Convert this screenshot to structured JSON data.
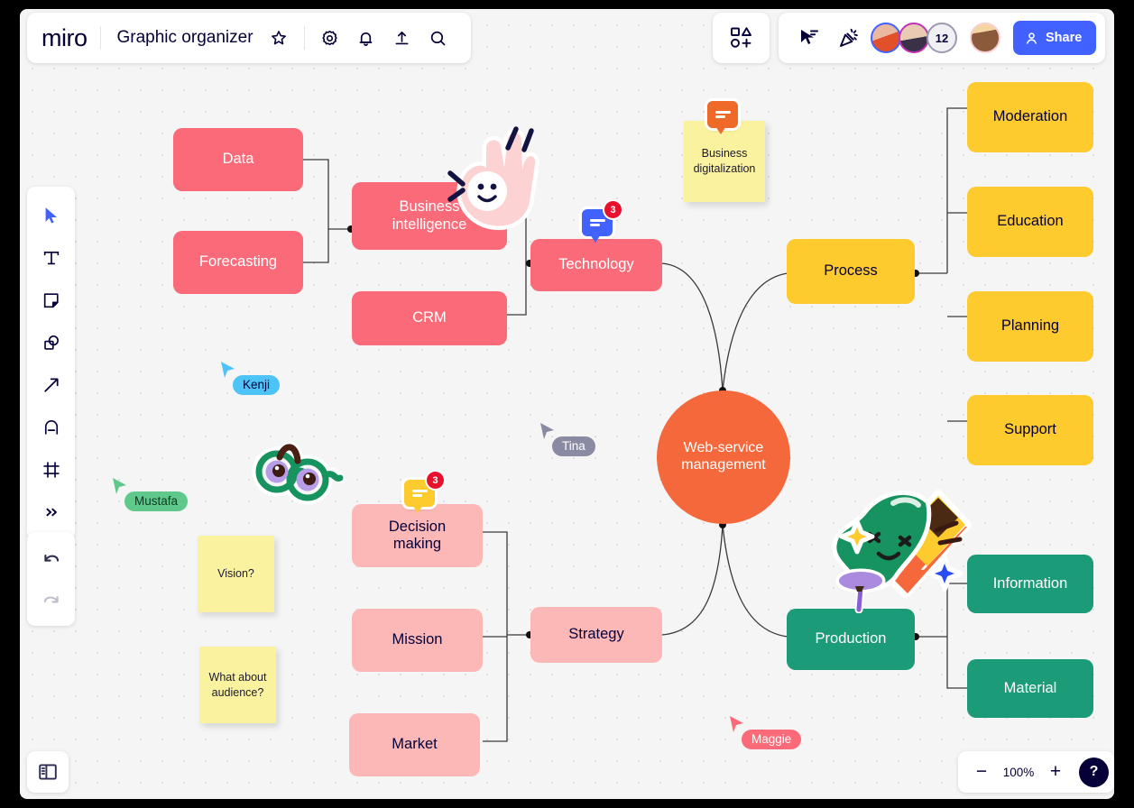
{
  "app": {
    "logo": "miro",
    "board_title": "Graphic organizer"
  },
  "header": {
    "icons": [
      "star-icon",
      "gear-icon",
      "bell-icon",
      "upload-icon",
      "search-icon"
    ],
    "shapes_button": "shapes-plus-icon",
    "present_icon": "present-icon",
    "celebrate_icon": "celebrate-icon",
    "collaborator_count": "12",
    "share_label": "Share"
  },
  "toolbar": {
    "tools": [
      {
        "name": "select-tool",
        "glyph": "cursor"
      },
      {
        "name": "text-tool",
        "glyph": "T"
      },
      {
        "name": "sticky-note-tool",
        "glyph": "note"
      },
      {
        "name": "shapes-tool",
        "glyph": "shapes"
      },
      {
        "name": "connector-tool",
        "glyph": "arrow"
      },
      {
        "name": "pen-tool",
        "glyph": "pen"
      },
      {
        "name": "frame-tool",
        "glyph": "frame"
      },
      {
        "name": "more-tools",
        "glyph": "»"
      }
    ],
    "undo": "undo-icon",
    "redo": "redo-icon"
  },
  "footer": {
    "panel_toggle": "panel-toggle-icon",
    "zoom_out": "−",
    "zoom_level": "100%",
    "zoom_in": "+",
    "help": "?"
  },
  "colors": {
    "red": "#fa6a78",
    "light_pink": "#fcb7b7",
    "yellow": "#fecb2e",
    "green": "#1c9b78",
    "orange": "#f4683c",
    "sticky_yellow": "#fbf2a0",
    "brand_blue": "#4262ff",
    "ink": "#050038"
  },
  "mindmap": {
    "center": {
      "label": "Web-service\nmanagement",
      "color": "#f4683c",
      "text": "#ffffff"
    },
    "branches": [
      {
        "label": "Technology",
        "color": "#fa6a78",
        "text": "#ffffff",
        "children": [
          {
            "label": "Business\nintelligence",
            "color": "#fa6a78",
            "text": "#ffffff",
            "children": [
              {
                "label": "Data",
                "color": "#fa6a78",
                "text": "#ffffff"
              },
              {
                "label": "Forecasting",
                "color": "#fa6a78",
                "text": "#ffffff"
              }
            ]
          },
          {
            "label": "CRM",
            "color": "#fa6a78",
            "text": "#ffffff"
          }
        ]
      },
      {
        "label": "Process",
        "color": "#fecb2e",
        "text": "#050038",
        "children": [
          {
            "label": "Moderation",
            "color": "#fecb2e",
            "text": "#050038"
          },
          {
            "label": "Education",
            "color": "#fecb2e",
            "text": "#050038"
          },
          {
            "label": "Planning",
            "color": "#fecb2e",
            "text": "#050038"
          },
          {
            "label": "Support",
            "color": "#fecb2e",
            "text": "#050038"
          }
        ]
      },
      {
        "label": "Strategy",
        "color": "#fcb7b7",
        "text": "#050038",
        "children": [
          {
            "label": "Decision\nmaking",
            "color": "#fcb7b7",
            "text": "#050038"
          },
          {
            "label": "Mission",
            "color": "#fcb7b7",
            "text": "#050038"
          },
          {
            "label": "Market",
            "color": "#fcb7b7",
            "text": "#050038"
          }
        ]
      },
      {
        "label": "Production",
        "color": "#1c9b78",
        "text": "#ffffff",
        "children": [
          {
            "label": "Information",
            "color": "#1c9b78",
            "text": "#ffffff"
          },
          {
            "label": "Material",
            "color": "#1c9b78",
            "text": "#ffffff"
          }
        ]
      }
    ]
  },
  "nodes": {
    "data": "Data",
    "forecasting": "Forecasting",
    "business_intelligence": "Business\nintelligence",
    "crm": "CRM",
    "technology": "Technology",
    "process": "Process",
    "moderation": "Moderation",
    "education": "Education",
    "planning": "Planning",
    "support": "Support",
    "center": "Web-service\nmanagement",
    "decision_making": "Decision\nmaking",
    "mission": "Mission",
    "market": "Market",
    "strategy": "Strategy",
    "production": "Production",
    "information": "Information",
    "material": "Material"
  },
  "stickies": [
    {
      "name": "sticky-business-digitalization",
      "text": "Business\ndigitalization"
    },
    {
      "name": "sticky-vision",
      "text": "Vision?"
    },
    {
      "name": "sticky-audience",
      "text": "What about\naudience?"
    }
  ],
  "comments": [
    {
      "name": "comment-orange",
      "color": "#ef6a28",
      "count": ""
    },
    {
      "name": "comment-blue",
      "color": "#4262ff",
      "count": "3"
    },
    {
      "name": "comment-yellow",
      "color": "#fecb2e",
      "count": "3"
    }
  ],
  "cursors": [
    {
      "name": "cursor-kenji",
      "label": "Kenji",
      "color": "#4ec3f7",
      "text": "#050038"
    },
    {
      "name": "cursor-mustafa",
      "label": "Mustafa",
      "color": "#5ec98b",
      "text": "#0b3a21"
    },
    {
      "name": "cursor-tina",
      "label": "Tina",
      "color": "#8a8aa3",
      "text": "#ffffff"
    },
    {
      "name": "cursor-maggie",
      "label": "Maggie",
      "color": "#fa6a78",
      "text": "#ffffff"
    }
  ],
  "stickers": [
    {
      "name": "sticker-ok-hand"
    },
    {
      "name": "sticker-glasses"
    },
    {
      "name": "sticker-party-popper"
    },
    {
      "name": "sticker-pin"
    }
  ]
}
